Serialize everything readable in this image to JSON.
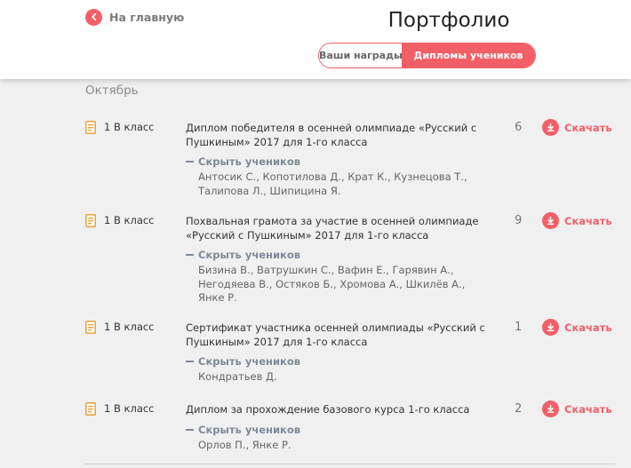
{
  "header": {
    "back_label": "На главную",
    "title": "Портфолио",
    "tabs": [
      {
        "label": "Ваши награды",
        "active": false
      },
      {
        "label": "Дипломы учеников",
        "active": true
      }
    ]
  },
  "month": "Октябрь",
  "common": {
    "download_label": "Скачать",
    "hide_students_label": "Скрыть учеников"
  },
  "awards": [
    {
      "class": "1 В класс",
      "title": "Диплом победителя в осенней олимпиаде «Русский с Пушкиным» 2017 для 1-го класса",
      "count": "6",
      "students": "Антосик С., Копотилова Д., Крат К., Кузнецова Т., Талипова Л., Шипицина Я."
    },
    {
      "class": "1 В класс",
      "title": "Похвальная грамота за участие в осенней олимпиаде «Русский с Пушкиным» 2017 для 1-го класса",
      "count": "9",
      "students": "Бизина В., Ватрушкин С., Вафин Е., Гарявин А., Негодяева В., Остяков Б., Хромова А., Шкилёв А., Янке Р."
    },
    {
      "class": "1 В класс",
      "title": "Сертификат участника осенней олимпиады «Русский с Пушкиным» 2017 для 1-го класса",
      "count": "1",
      "students": "Кондратьев Д."
    },
    {
      "class": "1 В класс",
      "title": "Диплом за прохождение базового курса 1-го класса",
      "count": "2",
      "students": "Орлов П., Янке Р."
    }
  ],
  "colors": {
    "accent": "#f35f67",
    "muted": "#7e8a99",
    "icon": "#e9a23b"
  }
}
